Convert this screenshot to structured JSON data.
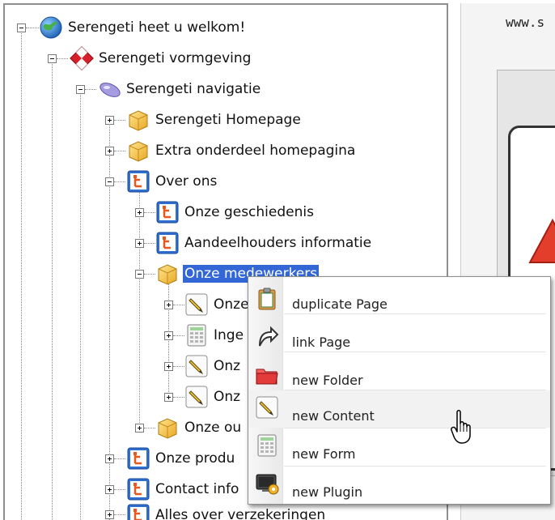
{
  "tree": {
    "nodes": [
      {
        "label": "Serengeti heet u welkom!",
        "icon": "globe-icon"
      },
      {
        "label": "Serengeti vormgeving",
        "icon": "design-icon"
      },
      {
        "label": "Serengeti navigatie",
        "icon": "navigation-icon"
      },
      {
        "label": "Serengeti Homepage",
        "icon": "box-icon"
      },
      {
        "label": "Extra onderdeel homepagina",
        "icon": "box-icon"
      },
      {
        "label": "Over ons",
        "icon": "page-tree-icon"
      },
      {
        "label": "Onze geschiedenis",
        "icon": "page-tree-icon"
      },
      {
        "label": "Aandeelhouders informatie",
        "icon": "page-tree-icon"
      },
      {
        "label": "Onze medewerkers",
        "icon": "box-icon",
        "selected": true
      },
      {
        "label": "Onze",
        "icon": "pen-icon"
      },
      {
        "label": "Inge",
        "icon": "form-icon"
      },
      {
        "label": "Onz",
        "icon": "pen-icon"
      },
      {
        "label": "Onz",
        "icon": "pen-icon"
      },
      {
        "label": "Onze ou",
        "icon": "box-icon"
      },
      {
        "label": "Onze produ",
        "icon": "page-tree-icon"
      },
      {
        "label": "Contact info",
        "icon": "page-tree-icon"
      },
      {
        "label": "Alles over verzekeringen",
        "icon": "page-tree-icon"
      }
    ]
  },
  "preview": {
    "url": "www.s"
  },
  "context_menu": {
    "items": [
      {
        "label": "duplicate Page",
        "icon": "clipboard-icon"
      },
      {
        "label": "link Page",
        "icon": "link-arrow-icon"
      },
      {
        "label": "new Folder",
        "icon": "folder-icon"
      },
      {
        "label": "new Content",
        "icon": "pen-icon"
      },
      {
        "label": "new Form",
        "icon": "form-icon"
      },
      {
        "label": "new Plugin",
        "icon": "plugin-icon"
      }
    ]
  },
  "colors": {
    "selection": "#3367d6",
    "accent_blue": "#2e6fd1",
    "box_yellow": "#f5c94a"
  }
}
